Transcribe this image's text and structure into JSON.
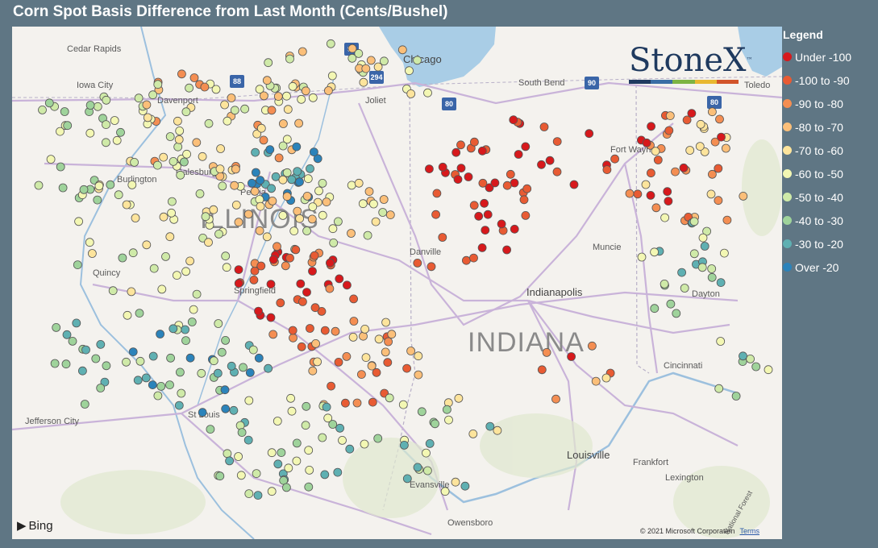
{
  "title": "Corn Spot Basis Difference from Last Month (Cents/Bushel)",
  "legend": {
    "title": "Legend",
    "items": [
      {
        "label": "Under -100",
        "color": "#d7191c"
      },
      {
        "label": "-100 to -90",
        "color": "#e85b33"
      },
      {
        "label": "-90 to -80",
        "color": "#f48e52"
      },
      {
        "label": "-80 to -70",
        "color": "#fbbf79"
      },
      {
        "label": "-70 to -60",
        "color": "#fde49c"
      },
      {
        "label": "-60 to -50",
        "color": "#f3f7b3"
      },
      {
        "label": "-50 to -40",
        "color": "#cfeaa8"
      },
      {
        "label": "-40 to -30",
        "color": "#9fd39b"
      },
      {
        "label": "-30 to -20",
        "color": "#5fb0b2"
      },
      {
        "label": "Over -20",
        "color": "#2b83ba"
      }
    ]
  },
  "map": {
    "states": [
      "ILLINOIS",
      "INDIANA"
    ],
    "cities": [
      "Cedar Rapids",
      "Iowa City",
      "Davenport",
      "Chicago",
      "South Bend",
      "Toledo",
      "Joliet",
      "Galesburg",
      "Peoria",
      "Fort Wayne",
      "Danville",
      "Muncie",
      "Springfield",
      "Indianapolis",
      "Dayton",
      "Cincinnati",
      "Jefferson City",
      "St Louis",
      "Louisville",
      "Frankfort",
      "Evansville",
      "Lexington",
      "Owensboro",
      "Quincy",
      "Burlington",
      "National Forest"
    ],
    "highways": [
      "90",
      "294",
      "88",
      "80",
      "90",
      "80"
    ],
    "attribution": "© 2021 Microsoft Corporation",
    "terms": "Terms",
    "provider": "Bing"
  },
  "brand": {
    "name": "StoneX",
    "tm": "™",
    "bar_colors": [
      "#1f3a5f",
      "#3a6ea5",
      "#7db343",
      "#e8b830",
      "#d2542a"
    ]
  }
}
